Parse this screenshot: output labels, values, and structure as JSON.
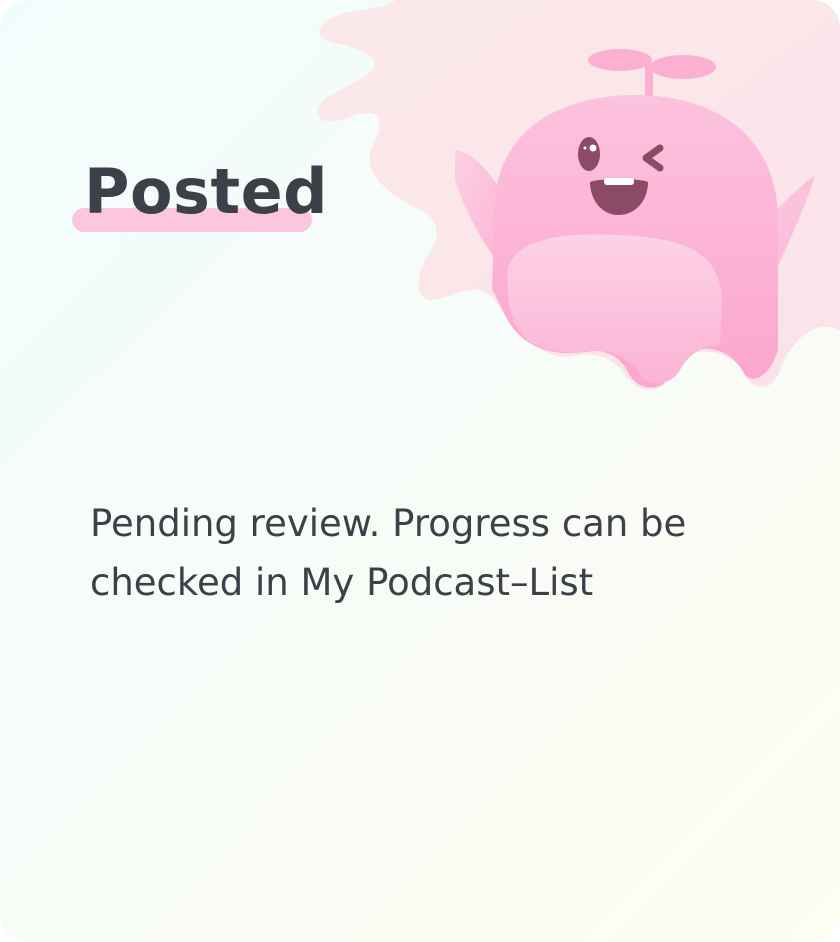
{
  "dialog": {
    "title": "Posted",
    "message": "Pending review. Progress can be checked in My Podcast–List"
  },
  "illustration": {
    "name": "waving-pink-mascot",
    "accent_color": "#fcc6df",
    "body_color": "#fbb6d8",
    "blob_color": "#fbe6ea"
  },
  "colors": {
    "text": "#3d4049",
    "background_start": "#f1fdfd",
    "background_end": "#fdfdf1"
  }
}
